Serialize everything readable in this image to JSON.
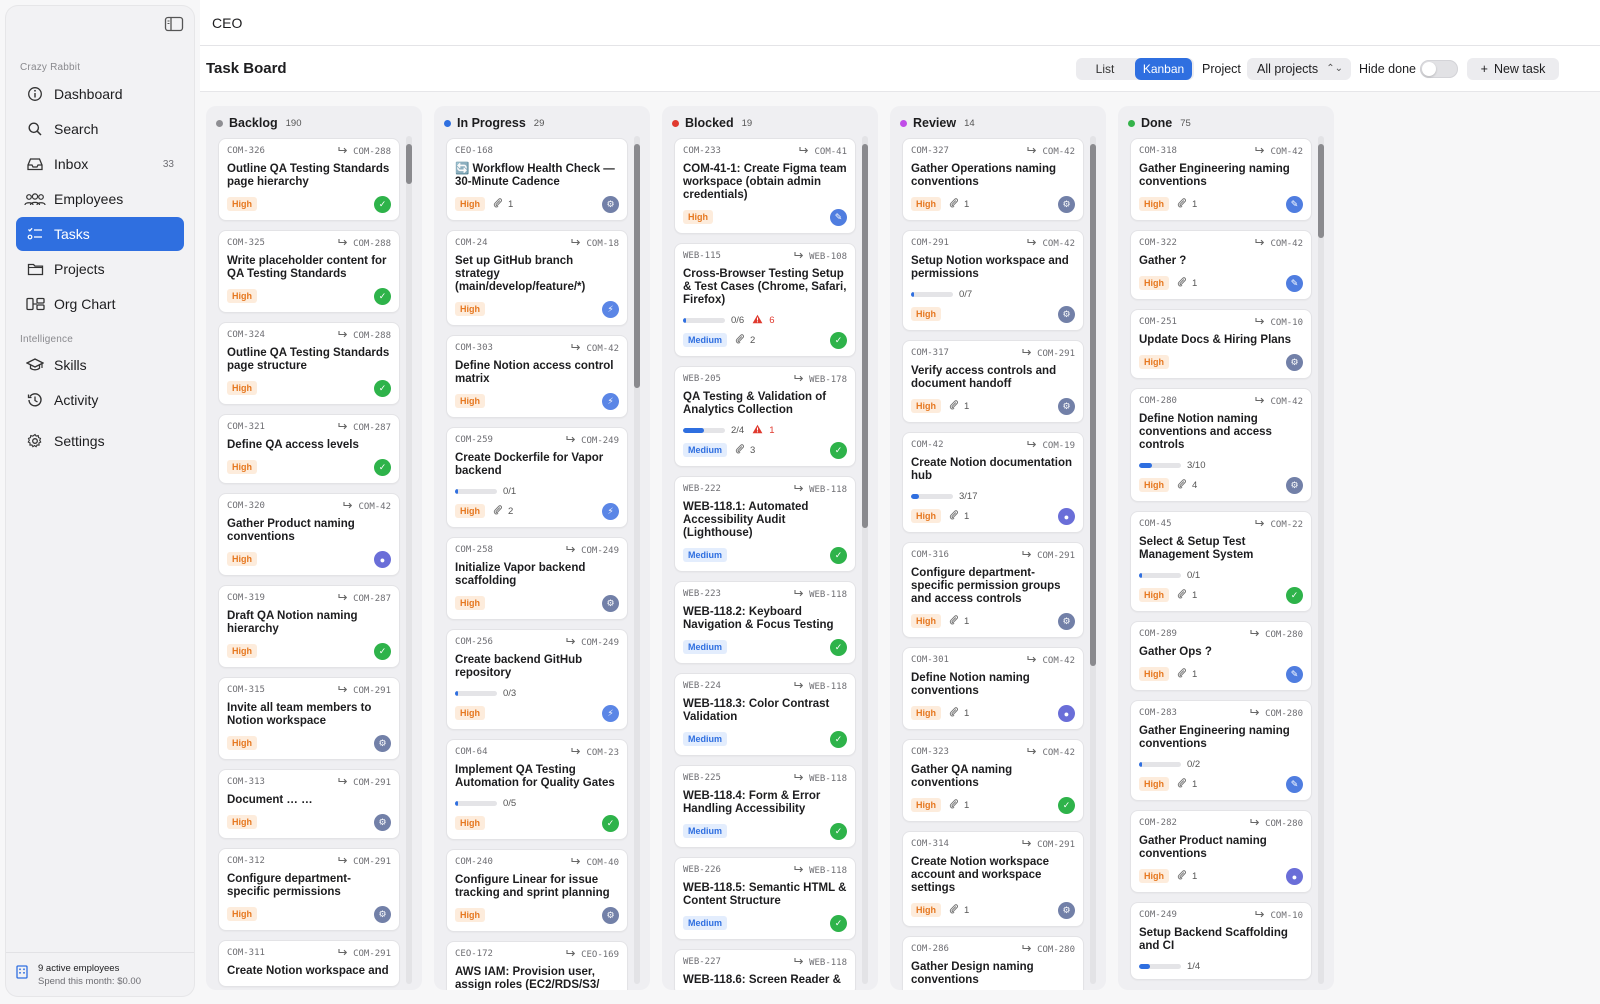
{
  "sidebar": {
    "workspace": "Crazy Rabbit",
    "items": [
      {
        "label": "Dashboard",
        "icon": "dashboard-icon"
      },
      {
        "label": "Search",
        "icon": "search-icon"
      },
      {
        "label": "Inbox",
        "icon": "inbox-icon",
        "count": "33"
      },
      {
        "label": "Employees",
        "icon": "people-icon"
      },
      {
        "label": "Tasks",
        "icon": "tasks-icon",
        "active": true
      },
      {
        "label": "Projects",
        "icon": "folder-icon"
      },
      {
        "label": "Org Chart",
        "icon": "org-chart-icon"
      }
    ],
    "intelligence_label": "Intelligence",
    "intel_items": [
      {
        "label": "Skills",
        "icon": "graduation-cap-icon"
      },
      {
        "label": "Activity",
        "icon": "history-icon"
      }
    ],
    "settings_label": "Settings",
    "footer": {
      "line1": "9 active employees",
      "line2": "Spend this month: $0.00"
    }
  },
  "topbar": {
    "title": "CEO"
  },
  "header": {
    "title": "Task Board",
    "view_list": "List",
    "view_kanban": "Kanban",
    "project_label": "Project",
    "project_value": "All projects",
    "hide_done_label": "Hide done",
    "hide_done": false,
    "new_task": "New task"
  },
  "colors": {
    "accent": "#2f6fe0",
    "high": "#e67820",
    "medium": "#2f6fe0",
    "backlog": "#8e8e93",
    "in_progress": "#2f6fe0",
    "blocked": "#e03a2f",
    "review": "#c04de8",
    "done": "#34b34a"
  },
  "columns": [
    {
      "name": "Backlog",
      "count": "190",
      "dot": "#8e8e93",
      "cards": [
        {
          "id": "COM-326",
          "parent": "COM-288",
          "title": "Outline QA Testing Standards page hierarchy",
          "priority": "High",
          "avatar": "check"
        },
        {
          "id": "COM-325",
          "parent": "COM-288",
          "title": "Write placeholder content for QA Testing Standards",
          "priority": "High",
          "avatar": "check"
        },
        {
          "id": "COM-324",
          "parent": "COM-288",
          "title": "Outline QA Testing Standards page structure",
          "priority": "High",
          "avatar": "check"
        },
        {
          "id": "COM-321",
          "parent": "COM-287",
          "title": "Define QA access levels",
          "priority": "High",
          "avatar": "check"
        },
        {
          "id": "COM-320",
          "parent": "COM-42",
          "title": "Gather Product naming conventions",
          "priority": "High",
          "avatar": "ball"
        },
        {
          "id": "COM-319",
          "parent": "COM-287",
          "title": "Draft QA Notion naming hierarchy",
          "priority": "High",
          "avatar": "check"
        },
        {
          "id": "COM-315",
          "parent": "COM-291",
          "title": "Invite all team members to Notion workspace",
          "priority": "High",
          "avatar": "gear"
        },
        {
          "id": "COM-313",
          "parent": "COM-291",
          "title": "Document … …",
          "priority": "High",
          "avatar": "gear"
        },
        {
          "id": "COM-312",
          "parent": "COM-291",
          "title": "Configure department-specific permissions",
          "priority": "High",
          "avatar": "gear"
        },
        {
          "id": "COM-311",
          "parent": "COM-291",
          "title": "Create Notion workspace and",
          "priority": "",
          "avatar": ""
        }
      ]
    },
    {
      "name": "In Progress",
      "count": "29",
      "dot": "#2f6fe0",
      "cards": [
        {
          "id": "CEO-168",
          "parent": "",
          "title": "🔄 Workflow Health Check — 30-Minute Cadence",
          "priority": "High",
          "attachments": "1",
          "avatar": "gear"
        },
        {
          "id": "COM-24",
          "parent": "COM-18",
          "title": "Set up GitHub branch strategy (main/develop/feature/*)",
          "priority": "High",
          "avatar": "bolt"
        },
        {
          "id": "COM-303",
          "parent": "COM-42",
          "title": "Define Notion access control matrix",
          "priority": "High",
          "avatar": "bolt"
        },
        {
          "id": "COM-259",
          "parent": "COM-249",
          "title": "Create Dockerfile for Vapor backend",
          "progress": "0/1",
          "pct": 0.04,
          "priority": "High",
          "attachments": "2",
          "avatar": "bolt"
        },
        {
          "id": "COM-258",
          "parent": "COM-249",
          "title": "Initialize Vapor backend scaffolding",
          "priority": "High",
          "avatar": "gear"
        },
        {
          "id": "COM-256",
          "parent": "COM-249",
          "title": "Create backend GitHub repository",
          "progress": "0/3",
          "pct": 0.04,
          "priority": "High",
          "avatar": "bolt"
        },
        {
          "id": "COM-64",
          "parent": "COM-23",
          "title": "Implement QA Testing Automation for Quality Gates",
          "progress": "0/5",
          "pct": 0.04,
          "priority": "High",
          "avatar": "check"
        },
        {
          "id": "COM-240",
          "parent": "COM-40",
          "title": "Configure Linear for issue tracking and sprint planning",
          "priority": "High",
          "avatar": "gear"
        },
        {
          "id": "CEO-172",
          "parent": "CEO-169",
          "title": "AWS IAM: Provision user, assign roles (EC2/RDS/S3/",
          "priority": "",
          "avatar": ""
        }
      ]
    },
    {
      "name": "Blocked",
      "count": "19",
      "dot": "#e03a2f",
      "cards": [
        {
          "id": "COM-233",
          "parent": "COM-41",
          "title": "COM-41-1: Create Figma team workspace (obtain admin credentials)",
          "priority": "High",
          "avatar": "pen"
        },
        {
          "id": "WEB-115",
          "parent": "WEB-108",
          "title": "Cross-Browser Testing Setup & Test Cases (Chrome, Safari, Firefox)",
          "progress": "0/6",
          "pct": 0.04,
          "warn": "6",
          "priority": "Medium",
          "attachments": "2",
          "avatar": "check"
        },
        {
          "id": "WEB-205",
          "parent": "WEB-178",
          "title": "QA Testing & Validation of Analytics Collection",
          "progress": "2/4",
          "pct": 0.5,
          "warn": "1",
          "priority": "Medium",
          "attachments": "3",
          "avatar": "check"
        },
        {
          "id": "WEB-222",
          "parent": "WEB-118",
          "title": "WEB-118.1: Automated Accessibility Audit (Lighthouse)",
          "priority": "Medium",
          "avatar": "check"
        },
        {
          "id": "WEB-223",
          "parent": "WEB-118",
          "title": "WEB-118.2: Keyboard Navigation & Focus Testing",
          "priority": "Medium",
          "avatar": "check"
        },
        {
          "id": "WEB-224",
          "parent": "WEB-118",
          "title": "WEB-118.3: Color Contrast Validation",
          "priority": "Medium",
          "avatar": "check"
        },
        {
          "id": "WEB-225",
          "parent": "WEB-118",
          "title": "WEB-118.4: Form & Error Handling Accessibility",
          "priority": "Medium",
          "avatar": "check"
        },
        {
          "id": "WEB-226",
          "parent": "WEB-118",
          "title": "WEB-118.5: Semantic HTML & Content Structure",
          "priority": "Medium",
          "avatar": "check"
        },
        {
          "id": "WEB-227",
          "parent": "WEB-118",
          "title": "WEB-118.6: Screen Reader &",
          "priority": "",
          "avatar": ""
        }
      ]
    },
    {
      "name": "Review",
      "count": "14",
      "dot": "#c04de8",
      "cards": [
        {
          "id": "COM-327",
          "parent": "COM-42",
          "title": "Gather Operations naming conventions",
          "priority": "High",
          "attachments": "1",
          "avatar": "gear"
        },
        {
          "id": "COM-291",
          "parent": "COM-42",
          "title": "Setup Notion workspace and permissions",
          "progress": "0/7",
          "pct": 0.04,
          "priority": "High",
          "avatar": "gear"
        },
        {
          "id": "COM-317",
          "parent": "COM-291",
          "title": "Verify access controls and document handoff",
          "priority": "High",
          "attachments": "1",
          "avatar": "gear"
        },
        {
          "id": "COM-42",
          "parent": "COM-19",
          "title": "Create Notion documentation hub",
          "progress": "3/17",
          "pct": 0.18,
          "priority": "High",
          "attachments": "1",
          "avatar": "ball"
        },
        {
          "id": "COM-316",
          "parent": "COM-291",
          "title": "Configure department-specific permission groups and access controls",
          "priority": "High",
          "attachments": "1",
          "avatar": "gear"
        },
        {
          "id": "COM-301",
          "parent": "COM-42",
          "title": "Define Notion naming conventions",
          "priority": "High",
          "attachments": "1",
          "avatar": "ball"
        },
        {
          "id": "COM-323",
          "parent": "COM-42",
          "title": "Gather QA naming conventions",
          "priority": "High",
          "attachments": "1",
          "avatar": "check"
        },
        {
          "id": "COM-314",
          "parent": "COM-291",
          "title": "Create Notion workspace account and workspace settings",
          "priority": "High",
          "attachments": "1",
          "avatar": "gear"
        },
        {
          "id": "COM-286",
          "parent": "COM-280",
          "title": "Gather Design naming conventions",
          "progress": "0/1",
          "pct": 0.04,
          "priority": "",
          "avatar": ""
        }
      ]
    },
    {
      "name": "Done",
      "count": "75",
      "dot": "#34b34a",
      "cards": [
        {
          "id": "COM-318",
          "parent": "COM-42",
          "title": "Gather Engineering naming conventions",
          "priority": "High",
          "attachments": "1",
          "avatar": "pen"
        },
        {
          "id": "COM-322",
          "parent": "COM-42",
          "title": "Gather  ?",
          "priority": "High",
          "attachments": "1",
          "avatar": "pen"
        },
        {
          "id": "COM-251",
          "parent": "COM-10",
          "title": "Update Docs & Hiring Plans",
          "priority": "High",
          "avatar": "gear"
        },
        {
          "id": "COM-280",
          "parent": "COM-42",
          "title": "Define Notion naming conventions and access controls",
          "progress": "3/10",
          "pct": 0.3,
          "priority": "High",
          "attachments": "4",
          "avatar": "gear"
        },
        {
          "id": "COM-45",
          "parent": "COM-22",
          "title": "Select & Setup Test Management System",
          "progress": "0/1",
          "pct": 0.04,
          "priority": "High",
          "attachments": "1",
          "avatar": "check"
        },
        {
          "id": "COM-289",
          "parent": "COM-280",
          "title": "Gather Ops ?",
          "priority": "High",
          "attachments": "1",
          "avatar": "pen"
        },
        {
          "id": "COM-283",
          "parent": "COM-280",
          "title": "Gather Engineering naming conventions",
          "progress": "0/2",
          "pct": 0.04,
          "priority": "High",
          "attachments": "1",
          "avatar": "pen"
        },
        {
          "id": "COM-282",
          "parent": "COM-280",
          "title": "Gather Product naming conventions",
          "priority": "High",
          "attachments": "1",
          "avatar": "ball"
        },
        {
          "id": "COM-249",
          "parent": "COM-10",
          "title": "Setup Backend Scaffolding and CI",
          "progress": "1/4",
          "pct": 0.25,
          "priority": "",
          "avatar": ""
        }
      ]
    }
  ]
}
